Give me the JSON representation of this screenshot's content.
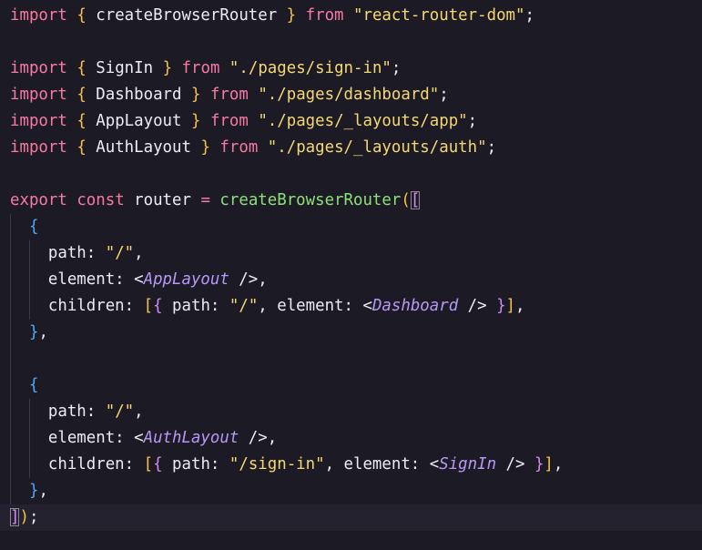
{
  "editor": {
    "colors": {
      "background": "#1c1a24",
      "keyword": "#f77aa4",
      "string": "#f5d872",
      "function": "#8de07a",
      "jsx_component": "#b59af5",
      "bracket_level_1": "#f6c24a",
      "bracket_level_2": "#d18bf2",
      "bracket_level_3": "#4ea9f5",
      "text": "#eeeaf8"
    },
    "lines": [
      [
        {
          "t": "import",
          "c": "keyword"
        },
        {
          "t": " ",
          "c": "punct"
        },
        {
          "t": "{",
          "c": "brace1"
        },
        {
          "t": " createBrowserRouter ",
          "c": "ident"
        },
        {
          "t": "}",
          "c": "brace1"
        },
        {
          "t": " ",
          "c": "punct"
        },
        {
          "t": "from",
          "c": "keyword"
        },
        {
          "t": " ",
          "c": "punct"
        },
        {
          "t": "\"react-router-dom\"",
          "c": "string"
        },
        {
          "t": ";",
          "c": "punct"
        }
      ],
      [],
      [
        {
          "t": "import",
          "c": "keyword"
        },
        {
          "t": " ",
          "c": "punct"
        },
        {
          "t": "{",
          "c": "brace1"
        },
        {
          "t": " SignIn ",
          "c": "ident"
        },
        {
          "t": "}",
          "c": "brace1"
        },
        {
          "t": " ",
          "c": "punct"
        },
        {
          "t": "from",
          "c": "keyword"
        },
        {
          "t": " ",
          "c": "punct"
        },
        {
          "t": "\"./pages/sign-in\"",
          "c": "string"
        },
        {
          "t": ";",
          "c": "punct"
        }
      ],
      [
        {
          "t": "import",
          "c": "keyword"
        },
        {
          "t": " ",
          "c": "punct"
        },
        {
          "t": "{",
          "c": "brace1"
        },
        {
          "t": " Dashboard ",
          "c": "ident"
        },
        {
          "t": "}",
          "c": "brace1"
        },
        {
          "t": " ",
          "c": "punct"
        },
        {
          "t": "from",
          "c": "keyword"
        },
        {
          "t": " ",
          "c": "punct"
        },
        {
          "t": "\"./pages/dashboard\"",
          "c": "string"
        },
        {
          "t": ";",
          "c": "punct"
        }
      ],
      [
        {
          "t": "import",
          "c": "keyword"
        },
        {
          "t": " ",
          "c": "punct"
        },
        {
          "t": "{",
          "c": "brace1"
        },
        {
          "t": " AppLayout ",
          "c": "ident"
        },
        {
          "t": "}",
          "c": "brace1"
        },
        {
          "t": " ",
          "c": "punct"
        },
        {
          "t": "from",
          "c": "keyword"
        },
        {
          "t": " ",
          "c": "punct"
        },
        {
          "t": "\"./pages/_layouts/app\"",
          "c": "string"
        },
        {
          "t": ";",
          "c": "punct"
        }
      ],
      [
        {
          "t": "import",
          "c": "keyword"
        },
        {
          "t": " ",
          "c": "punct"
        },
        {
          "t": "{",
          "c": "brace1"
        },
        {
          "t": " AuthLayout ",
          "c": "ident"
        },
        {
          "t": "}",
          "c": "brace1"
        },
        {
          "t": " ",
          "c": "punct"
        },
        {
          "t": "from",
          "c": "keyword"
        },
        {
          "t": " ",
          "c": "punct"
        },
        {
          "t": "\"./pages/_layouts/auth\"",
          "c": "string"
        },
        {
          "t": ";",
          "c": "punct"
        }
      ],
      [],
      [
        {
          "t": "export",
          "c": "keyword"
        },
        {
          "t": " ",
          "c": "punct"
        },
        {
          "t": "const",
          "c": "keyword"
        },
        {
          "t": " router ",
          "c": "ident"
        },
        {
          "t": "=",
          "c": "op"
        },
        {
          "t": " ",
          "c": "punct"
        },
        {
          "t": "createBrowserRouter",
          "c": "func"
        },
        {
          "t": "(",
          "c": "brace1"
        },
        {
          "t": "[",
          "c": "brace2",
          "m": true
        }
      ],
      [
        {
          "t": "  ",
          "c": "punct"
        },
        {
          "t": "{",
          "c": "brace3"
        }
      ],
      [
        {
          "t": "    path",
          "c": "prop"
        },
        {
          "t": ": ",
          "c": "punct"
        },
        {
          "t": "\"/\"",
          "c": "string"
        },
        {
          "t": ",",
          "c": "punct"
        }
      ],
      [
        {
          "t": "    element",
          "c": "prop"
        },
        {
          "t": ": <",
          "c": "punct"
        },
        {
          "t": "AppLayout",
          "c": "jsx"
        },
        {
          "t": " />,",
          "c": "punct"
        }
      ],
      [
        {
          "t": "    children",
          "c": "prop"
        },
        {
          "t": ": ",
          "c": "punct"
        },
        {
          "t": "[",
          "c": "brace1"
        },
        {
          "t": "{",
          "c": "brace2"
        },
        {
          "t": " path",
          "c": "prop"
        },
        {
          "t": ": ",
          "c": "punct"
        },
        {
          "t": "\"/\"",
          "c": "string"
        },
        {
          "t": ", element: <",
          "c": "punct"
        },
        {
          "t": "Dashboard",
          "c": "jsx"
        },
        {
          "t": " /> ",
          "c": "punct"
        },
        {
          "t": "}",
          "c": "brace2"
        },
        {
          "t": "]",
          "c": "brace1"
        },
        {
          "t": ",",
          "c": "punct"
        }
      ],
      [
        {
          "t": "  ",
          "c": "punct"
        },
        {
          "t": "}",
          "c": "brace3"
        },
        {
          "t": ",",
          "c": "punct"
        }
      ],
      [],
      [
        {
          "t": "  ",
          "c": "punct"
        },
        {
          "t": "{",
          "c": "brace3"
        }
      ],
      [
        {
          "t": "    path",
          "c": "prop"
        },
        {
          "t": ": ",
          "c": "punct"
        },
        {
          "t": "\"/\"",
          "c": "string"
        },
        {
          "t": ",",
          "c": "punct"
        }
      ],
      [
        {
          "t": "    element",
          "c": "prop"
        },
        {
          "t": ": <",
          "c": "punct"
        },
        {
          "t": "AuthLayout",
          "c": "jsx"
        },
        {
          "t": " />,",
          "c": "punct"
        }
      ],
      [
        {
          "t": "    children",
          "c": "prop"
        },
        {
          "t": ": ",
          "c": "punct"
        },
        {
          "t": "[",
          "c": "brace1"
        },
        {
          "t": "{",
          "c": "brace2"
        },
        {
          "t": " path",
          "c": "prop"
        },
        {
          "t": ": ",
          "c": "punct"
        },
        {
          "t": "\"/sign-in\"",
          "c": "string"
        },
        {
          "t": ", element: <",
          "c": "punct"
        },
        {
          "t": "SignIn",
          "c": "jsx"
        },
        {
          "t": " /> ",
          "c": "punct"
        },
        {
          "t": "}",
          "c": "brace2"
        },
        {
          "t": "]",
          "c": "brace1"
        },
        {
          "t": ",",
          "c": "punct"
        }
      ],
      [
        {
          "t": "  ",
          "c": "punct"
        },
        {
          "t": "}",
          "c": "brace3"
        },
        {
          "t": ",",
          "c": "punct"
        }
      ],
      [
        {
          "t": "]",
          "c": "brace2",
          "m": true
        },
        {
          "t": ")",
          "c": "brace1"
        },
        {
          "t": ";",
          "c": "punct"
        }
      ]
    ],
    "current_line": 19,
    "guide_lines": [
      8,
      9,
      10,
      11,
      12,
      13,
      14,
      15,
      16,
      17,
      18
    ],
    "inner_guide_lines": [
      9,
      10,
      11,
      15,
      16,
      17
    ]
  }
}
